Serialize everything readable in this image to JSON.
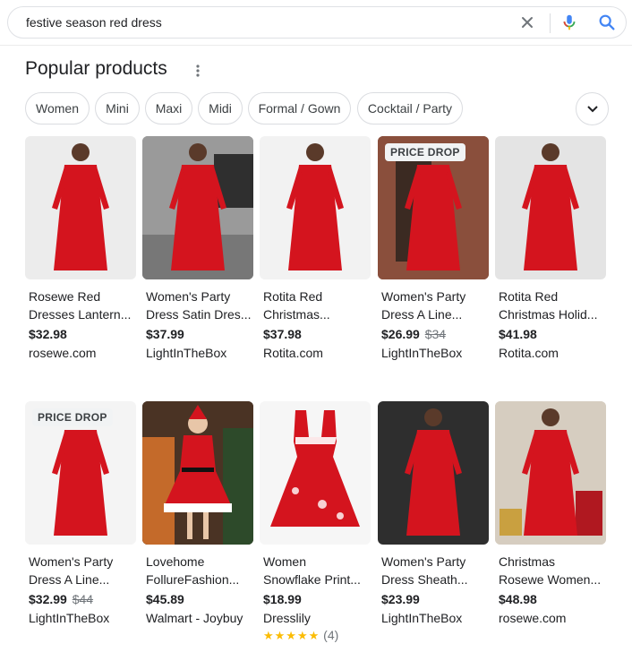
{
  "search": {
    "query": "festive season red dress"
  },
  "section": {
    "title": "Popular products"
  },
  "chips": [
    "Women",
    "Mini",
    "Maxi",
    "Midi",
    "Formal / Gown",
    "Cocktail / Party"
  ],
  "badge_text": "PRICE DROP",
  "products": [
    {
      "title1": "Rosewe Red",
      "title2": "Dresses Lantern...",
      "price": "$32.98",
      "old_price": "",
      "store": "rosewe.com",
      "badge": false,
      "scene": "studio",
      "bg": "#ececec"
    },
    {
      "title1": "Women's Party",
      "title2": "Dress Satin Dres...",
      "price": "$37.99",
      "old_price": "",
      "store": "LightInTheBox",
      "badge": false,
      "scene": "outdoor",
      "bg": "#8c8c8c"
    },
    {
      "title1": "Rotita Red",
      "title2": "Christmas...",
      "price": "$37.98",
      "old_price": "",
      "store": "Rotita.com",
      "badge": false,
      "scene": "studio",
      "bg": "#f2f2f2"
    },
    {
      "title1": "Women's Party",
      "title2": "Dress A Line...",
      "price": "$26.99",
      "old_price": "$34",
      "store": "LightInTheBox",
      "badge": true,
      "scene": "brick",
      "bg": "#7a4a3a"
    },
    {
      "title1": "Rotita Red",
      "title2": "Christmas Holid...",
      "price": "$41.98",
      "old_price": "",
      "store": "Rotita.com",
      "badge": false,
      "scene": "studio",
      "bg": "#e4e4e4"
    },
    {
      "title1": "Women's Party",
      "title2": "Dress A Line...",
      "price": "$32.99",
      "old_price": "$44",
      "store": "LightInTheBox",
      "badge": true,
      "scene": "studio",
      "bg": "#f4f4f4"
    },
    {
      "title1": "Lovehome",
      "title2": "FollureFashion...",
      "price": "$45.89",
      "old_price": "",
      "store": "Walmart - Joybuy",
      "badge": false,
      "scene": "santa",
      "bg": "#3d2a20"
    },
    {
      "title1": "Women",
      "title2": "Snowflake Print...",
      "price": "$18.99",
      "old_price": "",
      "store": "Dresslily",
      "badge": false,
      "scene": "flat",
      "bg": "#f6f6f6",
      "rating_count": "(4)"
    },
    {
      "title1": "Women's Party",
      "title2": "Dress Sheath...",
      "price": "$23.99",
      "old_price": "",
      "store": "LightInTheBox",
      "badge": false,
      "scene": "studio",
      "bg": "#2e2e2e"
    },
    {
      "title1": "Christmas",
      "title2": "Rosewe Women...",
      "price": "$48.98",
      "old_price": "",
      "store": "rosewe.com",
      "badge": false,
      "scene": "xmas",
      "bg": "#d9d2c8"
    }
  ],
  "icons": {
    "clear": "close-icon",
    "mic": "mic-icon",
    "search": "search-icon",
    "more": "more-vert-icon",
    "expand": "chevron-down-icon"
  },
  "colors": {
    "dress_red": "#d4141e",
    "star": "#fbbc04",
    "google_blue": "#4285f4"
  }
}
